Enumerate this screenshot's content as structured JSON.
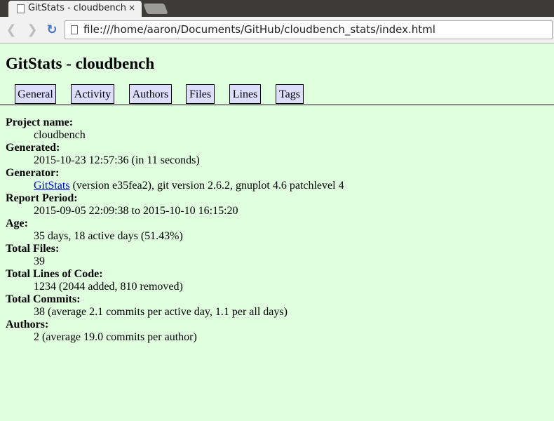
{
  "browser": {
    "tab_title": "GitStats - cloudbench",
    "tab_close": "×",
    "back_glyph": "❮",
    "forward_glyph": "❯",
    "reload_glyph": "↻",
    "url": "file:///home/aaron/Documents/GitHub/cloudbench_stats/index.html"
  },
  "page": {
    "title": "GitStats - cloudbench",
    "nav": [
      "General",
      "Activity",
      "Authors",
      "Files",
      "Lines",
      "Tags"
    ],
    "fields": {
      "project_name": {
        "label": "Project name:",
        "value": "cloudbench"
      },
      "generated": {
        "label": "Generated:",
        "value": "2015-10-23 12:57:36 (in 11 seconds)"
      },
      "generator": {
        "label": "Generator:",
        "link": "GitStats",
        "value": " (version e35fea2), git version 2.6.2, gnuplot 4.6 patchlevel 4"
      },
      "report_period": {
        "label": "Report Period:",
        "value": "2015-09-05 22:09:38 to 2015-10-10 16:15:20"
      },
      "age": {
        "label": "Age:",
        "value": "35 days, 18 active days (51.43%)"
      },
      "total_files": {
        "label": "Total Files:",
        "value": "39"
      },
      "total_loc": {
        "label": "Total Lines of Code:",
        "value": "1234 (2044 added, 810 removed)"
      },
      "total_commits": {
        "label": "Total Commits:",
        "value": "38 (average 2.1 commits per active day, 1.1 per all days)"
      },
      "authors": {
        "label": "Authors:",
        "value": "2 (average 19.0 commits per author)"
      }
    }
  },
  "colors": {
    "page_background": "#dfffdf",
    "nav_background": "#ddddff",
    "link": "#0000ee"
  }
}
